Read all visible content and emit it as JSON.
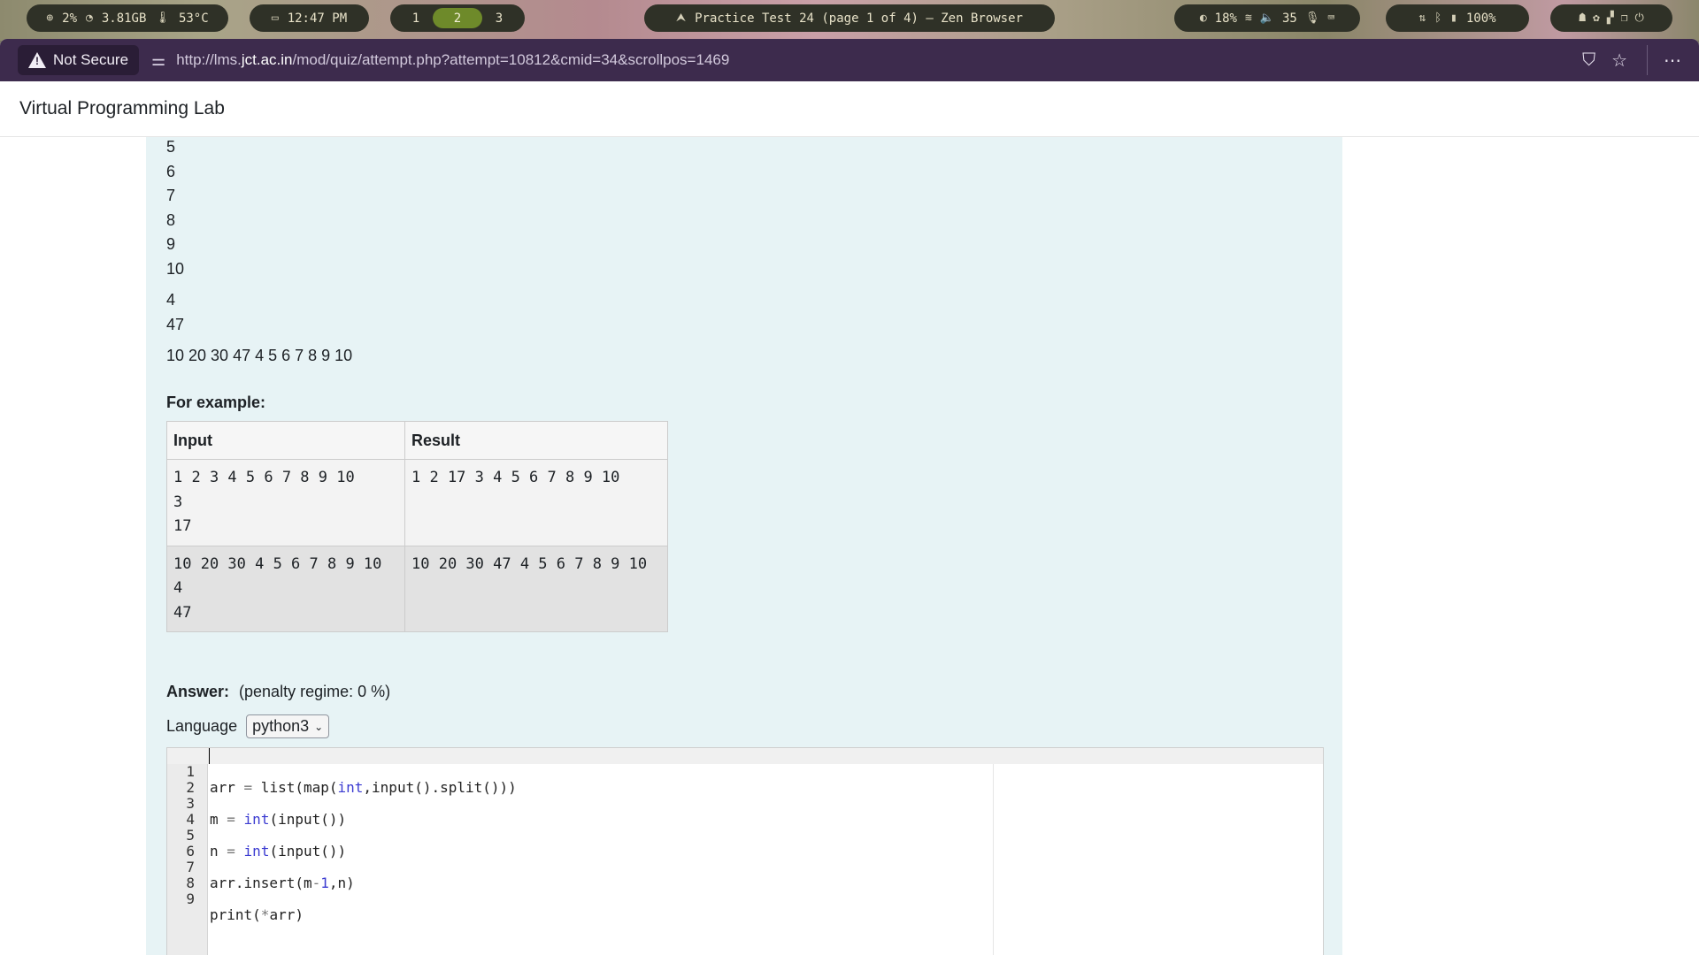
{
  "statusbar": {
    "cpu": "2%",
    "memory": "3.81GB",
    "temperature": "53°C",
    "time": "12:47 PM",
    "workspaces": [
      "1",
      "2",
      "3"
    ],
    "active_workspace": "2",
    "window_title": "Practice Test 24 (page 1 of 4) — Zen Browser",
    "brightness": "18%",
    "volume": "35",
    "battery": "100%"
  },
  "browser": {
    "security_label": "Not Secure",
    "url_prefix": "http://lms.",
    "url_host": "jct.ac.in",
    "url_path": "/mod/quiz/attempt.php?attempt=10812&cmid=34&scrollpos=1469"
  },
  "site": {
    "title": "Virtual Programming Lab"
  },
  "question": {
    "lines_top": [
      "5",
      "6",
      "7",
      "8",
      "9",
      "10"
    ],
    "lines_mid": [
      "4",
      "47"
    ],
    "line_output": "10 20 30 47 4 5 6 7 8 9 10",
    "example_title": "For example:",
    "table_headers": [
      "Input",
      "Result"
    ],
    "rows": [
      {
        "input": "1 2 3 4 5 6 7 8 9 10\n3\n17",
        "result": "1 2 17 3 4 5 6 7 8 9 10"
      },
      {
        "input": "10 20 30 4 5 6 7 8 9 10\n4\n47",
        "result": "10 20 30 47 4 5 6 7 8 9 10"
      }
    ]
  },
  "answer": {
    "label": "Answer:",
    "penalty": "(penalty regime: 0 %)",
    "language_label": "Language",
    "language_value": "python3"
  },
  "editor": {
    "line_numbers": [
      "1",
      "2",
      "3",
      "4",
      "5",
      "6",
      "7",
      "8",
      "9"
    ]
  }
}
